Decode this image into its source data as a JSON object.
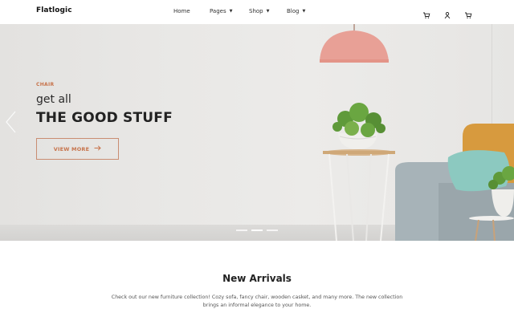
{
  "header": {
    "brand": "Flatlogic",
    "nav": [
      {
        "label": "Home",
        "has_caret": false
      },
      {
        "label": "Pages",
        "has_caret": true
      },
      {
        "label": "Shop",
        "has_caret": true
      },
      {
        "label": "Blog",
        "has_caret": true
      }
    ],
    "icons": [
      "cart-icon",
      "user-icon",
      "bag-icon"
    ]
  },
  "hero": {
    "eyebrow": "CHAIR",
    "headline": "get all",
    "title": "THE GOOD STUFF",
    "cta_label": "VIEW MORE",
    "slides_total": 3,
    "active_slide": 2,
    "colors": {
      "accent": "#c7734b",
      "lamp": "#e8a096",
      "chair_back": "#d79a3e",
      "cushion": "#8cc9c0",
      "sofa": "#a7b3b8"
    }
  },
  "section": {
    "title": "New Arrivals",
    "text": "Check out our new furniture collection! Cozy sofa, fancy chair, wooden casket, and many more. The new collection brings an informal elegance to your home."
  }
}
